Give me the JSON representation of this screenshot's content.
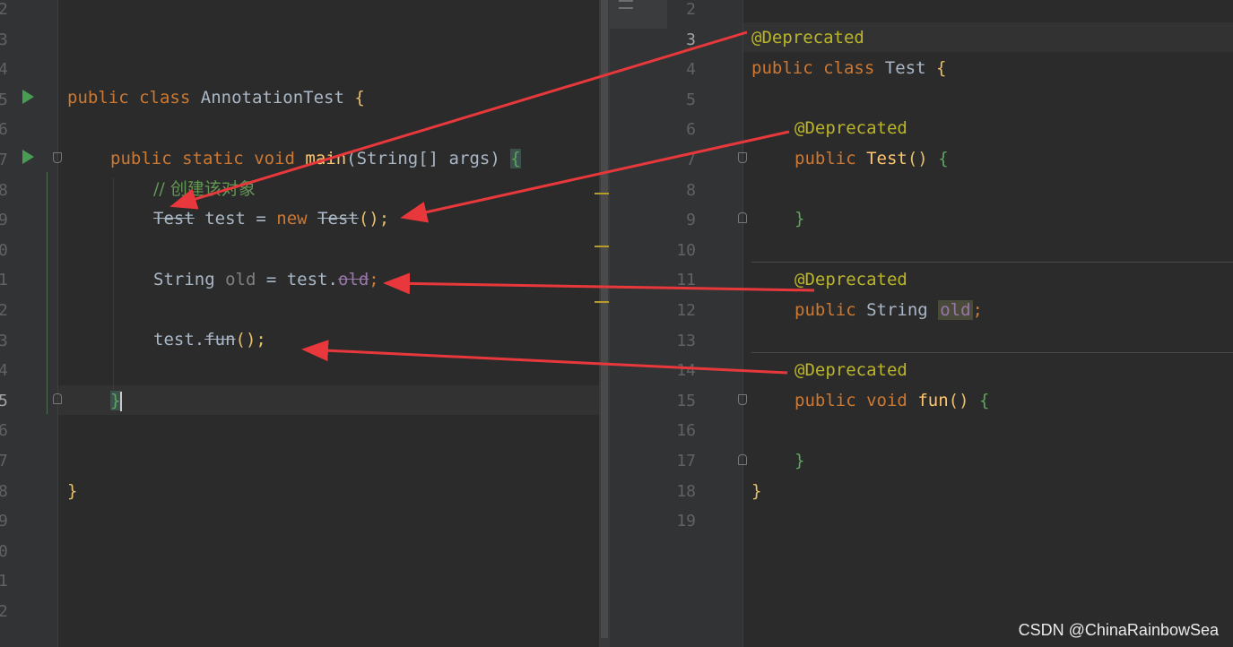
{
  "left_editor": {
    "line_numbers": [
      "2",
      "3",
      "4",
      "5",
      "6",
      "7",
      "8",
      "9",
      "0",
      "1",
      "2",
      "3",
      "4",
      "5",
      "6",
      "7",
      "8",
      "9",
      "0",
      "1",
      "2"
    ],
    "code": {
      "class_decl": {
        "kw1": "public",
        "kw2": "class",
        "name": "AnnotationTest",
        "brace": "{"
      },
      "main_decl": {
        "kw1": "public",
        "kw2": "static",
        "kw3": "void",
        "fn": "main",
        "args": "(String[] args)",
        "brace": "{"
      },
      "comment": "// 创建该对象",
      "new_line": {
        "type": "Test",
        "var": " test = ",
        "kw": "new",
        "ctor": "Test",
        "tail": "();"
      },
      "field_line": {
        "type": "String",
        "var": "old",
        "mid": " = test.",
        "field": "old",
        "tail": ";"
      },
      "call_line": {
        "obj": "test.",
        "fn": "fun",
        "tail": "();"
      },
      "main_close": "}",
      "class_close": "}"
    }
  },
  "right_editor": {
    "line_numbers": [
      "2",
      "3",
      "4",
      "5",
      "6",
      "7",
      "8",
      "9",
      "10",
      "11",
      "12",
      "13",
      "14",
      "15",
      "16",
      "17",
      "18",
      "19"
    ],
    "code": {
      "ann_class": "@Deprecated",
      "class_decl": {
        "kw1": "public",
        "kw2": "class",
        "name": "Test",
        "brace": "{"
      },
      "ann_ctor": "@Deprecated",
      "ctor_decl": {
        "kw": "public",
        "fn": "Test",
        "parens": "()",
        "brace": "{"
      },
      "ctor_close": "}",
      "ann_field": "@Deprecated",
      "field_decl": {
        "kw": "public",
        "type": "String",
        "field": "old",
        "semi": ";"
      },
      "ann_method": "@Deprecated",
      "method_decl": {
        "kw1": "public",
        "kw2": "void",
        "fn": "fun",
        "parens": "()",
        "brace": "{"
      },
      "method_close": "}",
      "class_close": "}"
    }
  },
  "watermark": "CSDN @ChinaRainbowSea",
  "colors": {
    "background": "#2b2b2b",
    "keyword": "#cc7832",
    "annotation": "#bbb529",
    "method": "#ffc66d",
    "field": "#9876aa",
    "comment": "#629755",
    "arrow": "#e8383c",
    "run_icon": "#499c54"
  },
  "icons": [
    "run-icon",
    "fold-icon",
    "minimap-icon"
  ]
}
